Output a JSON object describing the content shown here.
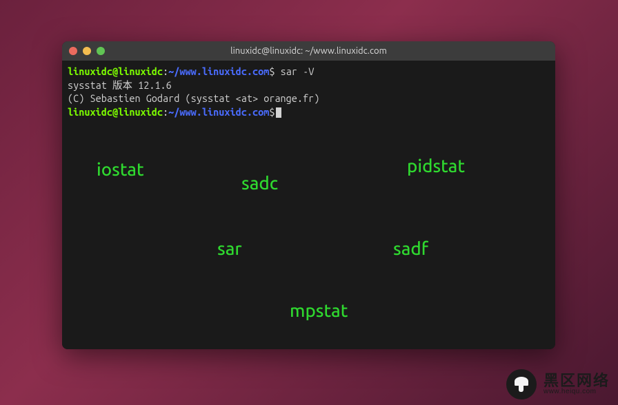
{
  "window": {
    "title": "linuxidc@linuxidc: ~/www.linuxidc.com"
  },
  "prompt": {
    "user_host": "linuxidc@linuxidc",
    "colon": ":",
    "path": "~/www.linuxidc.com",
    "dollar": "$"
  },
  "command1": " sar -V",
  "output": {
    "line1": "sysstat 版本 12.1.6",
    "line2": "(C) Sebastien Godard (sysstat <at> orange.fr)"
  },
  "overlays": {
    "iostat": "iostat",
    "sadc": "sadc",
    "pidstat": "pidstat",
    "sar": "sar",
    "sadf": "sadf",
    "mpstat": "mpstat"
  },
  "watermark": {
    "cn": "黑区网络",
    "en": "www.heiqu.com"
  }
}
